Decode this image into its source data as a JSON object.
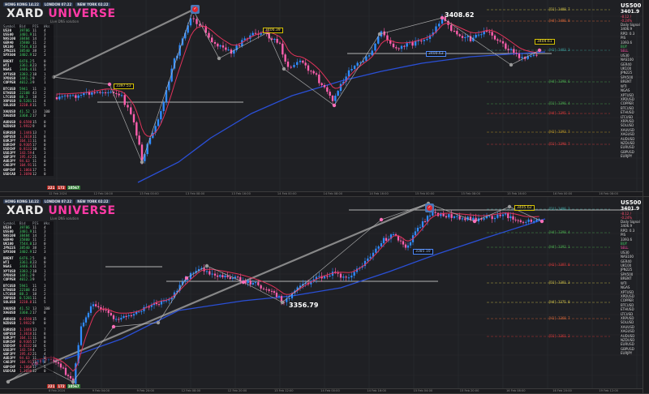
{
  "sessions": [
    "HONG KONG 14:22",
    "LONDON 07:22",
    "NEW YORK 02:22"
  ],
  "brand": {
    "part1": "XARD ",
    "part2": "UNIVERSE",
    "subtitle": "Live DNS solution"
  },
  "table": {
    "headers": [
      "Symbol",
      "Bid",
      "PIS",
      "Wks"
    ],
    "groups": [
      [
        {
          "s": "US30",
          "b": "39786",
          "p": "11",
          "w": "4",
          "t": "up"
        },
        {
          "s": "US500",
          "b": "3401.9",
          "p": "11",
          "w": "3",
          "t": "up"
        },
        {
          "s": "NAS100",
          "b": "38484",
          "p": "14",
          "w": "3",
          "t": "up"
        },
        {
          "s": "GER40",
          "b": "35800",
          "p": "11",
          "w": "2",
          "t": "up"
        },
        {
          "s": "UK100",
          "b": "7544.0",
          "p": "13",
          "w": "0",
          "t": "up"
        },
        {
          "s": "JPN225",
          "b": "38540",
          "p": "38",
          "w": "2",
          "t": "up"
        },
        {
          "s": "SPX500",
          "b": "3402.9",
          "p": "12",
          "w": "3",
          "t": "up"
        }
      ],
      [
        {
          "s": "BRENT",
          "b": "6476.2",
          "p": "5",
          "w": "0",
          "t": "up"
        },
        {
          "s": "WTI",
          "b": "3361.8",
          "p": "23",
          "w": "0",
          "t": "up"
        },
        {
          "s": "NGAS",
          "b": "3446.4",
          "p": "11",
          "w": "3",
          "t": "up"
        },
        {
          "s": "XPTUSD",
          "b": "3383.2",
          "p": "18",
          "w": "1",
          "t": "up"
        },
        {
          "s": "XPDUSD",
          "b": "1441.2",
          "p": "9",
          "w": "2",
          "t": "up"
        },
        {
          "s": "COPPER",
          "b": "4012.3",
          "p": "9",
          "w": "1",
          "t": "up"
        }
      ],
      [
        {
          "s": "BTCUSD",
          "b": "5941",
          "p": "11",
          "w": "3",
          "t": "up"
        },
        {
          "s": "ETHUSD",
          "b": "22108",
          "p": "43",
          "w": "2",
          "t": "up"
        },
        {
          "s": "LTCUSD",
          "b": "88.3",
          "p": "18",
          "w": "2",
          "t": "up"
        },
        {
          "s": "XRPUSD",
          "b": "0.5281",
          "p": "11",
          "w": "4",
          "t": "up"
        },
        {
          "s": "SOLUSD",
          "b": "3238.8",
          "p": "11",
          "w": "5",
          "t": "dn"
        }
      ],
      [
        {
          "s": "XAUUSD",
          "b": "41.52",
          "p": "13",
          "w": "100",
          "t": "up"
        },
        {
          "s": "XAGUSD",
          "b": "3360.2",
          "p": "17",
          "w": "0",
          "t": "up"
        }
      ],
      [
        {
          "s": "AUDUSD",
          "b": "0.6598",
          "p": "15",
          "w": "0",
          "t": "dn"
        },
        {
          "s": "NZDUSD",
          "b": "1.9932",
          "p": "9",
          "w": "0",
          "t": "dn"
        }
      ],
      [
        {
          "s": "EURUSD",
          "b": "1.1446",
          "p": "13",
          "w": "7",
          "t": "dn"
        },
        {
          "s": "GBPUSD",
          "b": "1.3618",
          "p": "11",
          "w": "8",
          "t": "dn"
        },
        {
          "s": "EURJPY",
          "b": "164.11",
          "p": "11",
          "w": "8",
          "t": "dn"
        },
        {
          "s": "EURCHF",
          "b": "0.9305",
          "p": "17",
          "w": "0",
          "t": "dn"
        },
        {
          "s": "USDCHF",
          "b": "0.8132",
          "p": "10",
          "w": "6",
          "t": "dn"
        },
        {
          "s": "USDJPY",
          "b": "143.59",
          "p": "4",
          "w": "3",
          "t": "dn"
        },
        {
          "s": "GBPJPY",
          "b": "195.42",
          "p": "21",
          "w": "4",
          "t": "dn"
        },
        {
          "s": "AUDJPY",
          "b": "94.63",
          "p": "11",
          "w": "0",
          "t": "dn"
        },
        {
          "s": "CADJPY",
          "b": "104.91",
          "p": "11",
          "w": "0",
          "t": "dn"
        },
        {
          "s": "GBPCHF",
          "b": "1.1066",
          "p": "17",
          "w": "5",
          "t": "dn"
        },
        {
          "s": "USDCAD",
          "b": "1.3690",
          "p": "12",
          "w": "0",
          "t": "dn"
        }
      ]
    ],
    "badges": [
      "221",
      "172",
      "10567"
    ]
  },
  "right_panel": {
    "name": "US500",
    "price": "3401.9",
    "change": "-8.12 / -0.24%",
    "items": [
      "Daily Signal",
      "3406.9",
      "RPD: 0.3",
      "PIS",
      "3393.6",
      "BUY",
      "SELL",
      "US30",
      "NAS100",
      "GER40",
      "UK100",
      "JPN225",
      "SPX500",
      "BRENT",
      "WTI",
      "NGAS",
      "XPTUSD",
      "XPDUSD",
      "COPPER",
      "BTCUSD",
      "ETHUSD",
      "LTCUSD",
      "XRPUSD",
      "SOLUSD",
      "XAUUSD",
      "XAGUSD",
      "AUDUSD",
      "NZDUSD",
      "EURUSD",
      "GBPUSD",
      "EURJPY"
    ]
  },
  "top_chart": {
    "labels": {
      "peak": "3408.62",
      "tag_left": "3397.53",
      "tag_mid": "3406.39",
      "tag_right": "3404.61",
      "tag_blue": "3400.63"
    },
    "levels": [
      {
        "name": "[D1] 3408.7",
        "color": "#d8c84a",
        "style": "dash"
      },
      {
        "name": "[H4] 3406.8",
        "color": "#e06a3a",
        "style": "dash"
      },
      {
        "name": "[H1] 3403.3",
        "color": "#3ea3a0",
        "style": "dash"
      },
      {
        "name": "[H4] 3398.6",
        "color": "#4caf50",
        "style": "dash"
      },
      {
        "name": "[D1] 3396.4",
        "color": "#4caf50",
        "style": "dash"
      },
      {
        "name": "[H4] 3395.1",
        "color": "#e03a3a",
        "style": "dash"
      },
      {
        "name": "[H1] 3393.7",
        "color": "#c9a227",
        "style": "dash"
      },
      {
        "name": "[D1] 3390.7",
        "color": "#e04040",
        "style": "dash"
      }
    ],
    "time_labels": [
      "12 Feb 2024",
      "12 Feb 16:00",
      "13 Feb 00:00",
      "13 Feb 08:00",
      "13 Feb 16:00",
      "14 Feb 00:00",
      "14 Feb 08:00",
      "14 Feb 16:00",
      "15 Feb 00:00",
      "15 Feb 08:00",
      "15 Feb 16:00",
      "16 Feb 00:00",
      "16 Feb 08:00"
    ]
  },
  "bottom_chart": {
    "labels": {
      "low": "3356.79",
      "tag_right": "3405.62",
      "tag_blue": "3385.10"
    },
    "levels": [
      {
        "name": "[D1] 3406.2",
        "color": "#3ea3a0",
        "style": "dash"
      },
      {
        "name": "[H4] 3398.4",
        "color": "#4caf50",
        "style": "dash"
      },
      {
        "name": "[H4] 3392.1",
        "color": "#4caf50",
        "style": "dash"
      },
      {
        "name": "[H1] 3387.0",
        "color": "#e03a3a",
        "style": "dash"
      },
      {
        "name": "[D1] 3381.3",
        "color": "#d8c84a",
        "style": "dash"
      },
      {
        "name": "[H4] 3375.8",
        "color": "#d8c84a",
        "style": "dash"
      },
      {
        "name": "[H1] 3368.7",
        "color": "#e06a3a",
        "style": "dash"
      },
      {
        "name": "[D1] 3361.2",
        "color": "#e03a3a",
        "style": "dash"
      }
    ],
    "time_labels": [
      "8 Feb 2024",
      "9 Feb 04:00",
      "9 Feb 20:00",
      "12 Feb 08:00",
      "12 Feb 20:00",
      "13 Feb 12:00",
      "14 Feb 00:00",
      "14 Feb 16:00",
      "15 Feb 04:00",
      "15 Feb 20:00",
      "16 Feb 08:00",
      "16 Feb 20:00",
      "19 Feb 12:00"
    ]
  },
  "colors": {
    "bull": "#2f8cff",
    "bear": "#ff5fae",
    "ema_fast": "#e0325a",
    "ema_slow": "#2a4fd6",
    "zigzag": "#bdbdbd",
    "trend": "#9a9a9a"
  }
}
